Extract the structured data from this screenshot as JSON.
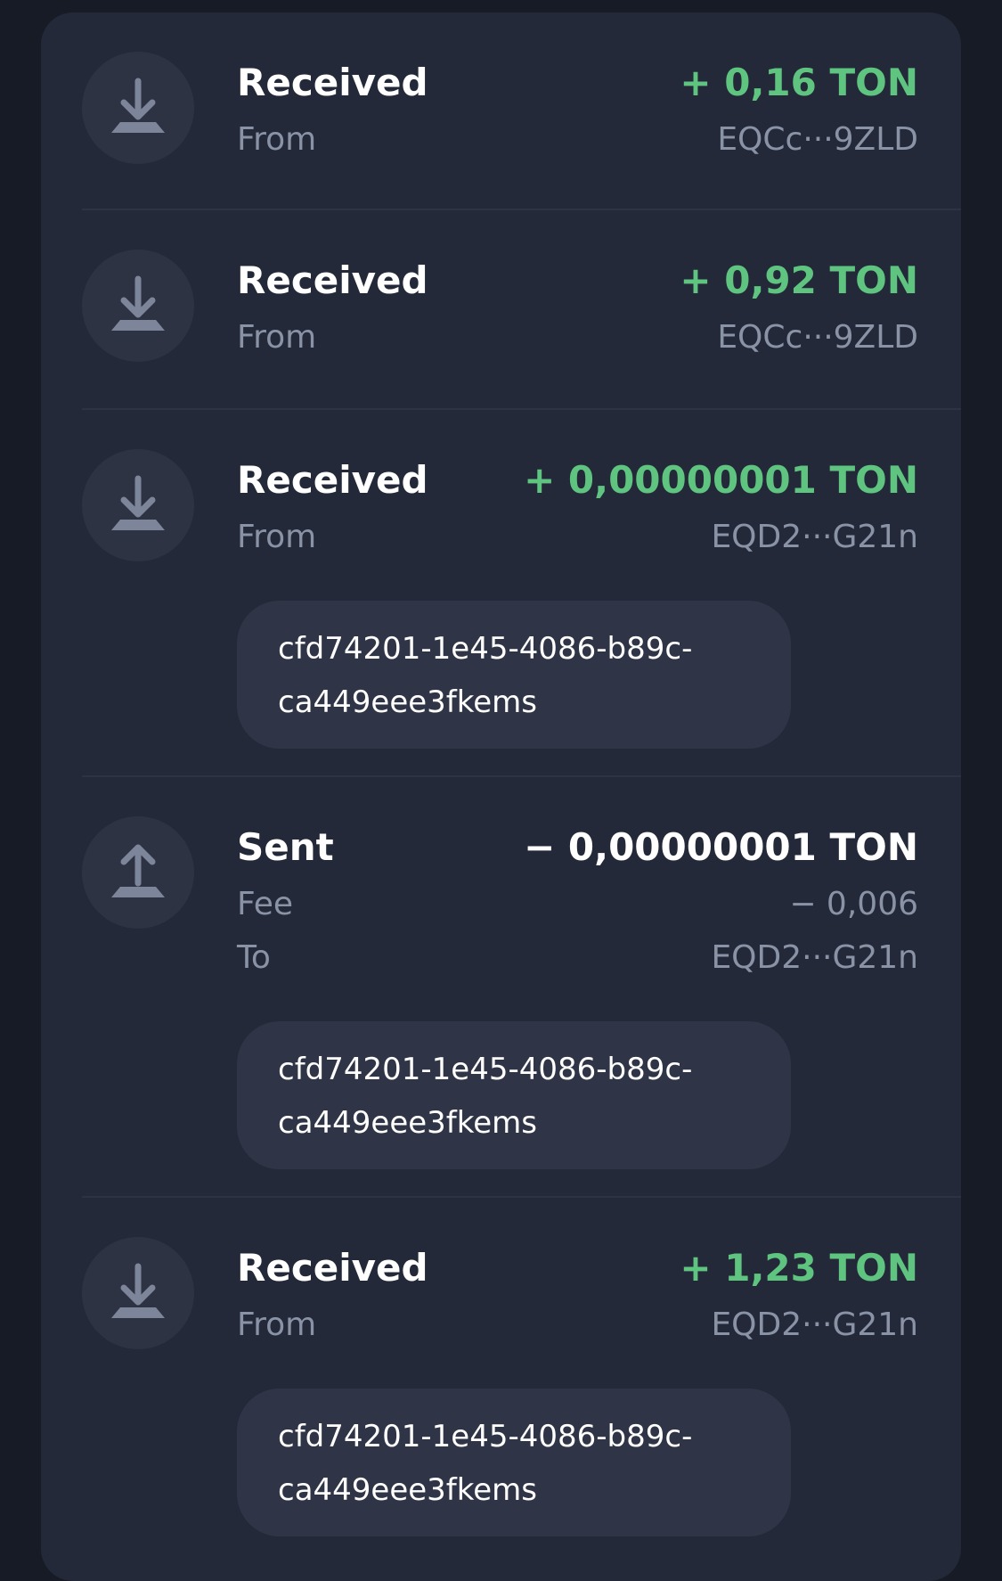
{
  "colors": {
    "background": "#161b26",
    "panel": "#232938",
    "incoming": "#5ec47f",
    "muted": "#8a93a6",
    "text": "#ffffff"
  },
  "transactions": [
    {
      "direction": "in",
      "icon": "arrow-down-icon",
      "title": "Received",
      "amount": "+ 0,16 TON",
      "address_label": "From",
      "address": "EQCc···9ZLD"
    },
    {
      "direction": "in",
      "icon": "arrow-down-icon",
      "title": "Received",
      "amount": "+ 0,92 TON",
      "address_label": "From",
      "address": "EQCc···9ZLD"
    },
    {
      "direction": "in",
      "icon": "arrow-down-icon",
      "title": "Received",
      "amount": "+ 0,00000001 TON",
      "address_label": "From",
      "address": "EQD2···G21n",
      "comment_line1": "cfd74201-1e45-4086-b89c-",
      "comment_line2": "ca449eee3fkems"
    },
    {
      "direction": "out",
      "icon": "arrow-up-icon",
      "title": "Sent",
      "amount": "− 0,00000001 TON",
      "fee_label": "Fee",
      "fee": "− 0,006",
      "address_label": "To",
      "address": "EQD2···G21n",
      "comment_line1": "cfd74201-1e45-4086-b89c-",
      "comment_line2": "ca449eee3fkems"
    },
    {
      "direction": "in",
      "icon": "arrow-down-icon",
      "title": "Received",
      "amount": "+ 1,23 TON",
      "address_label": "From",
      "address": "EQD2···G21n",
      "comment_line1": "cfd74201-1e45-4086-b89c-",
      "comment_line2": "ca449eee3fkems"
    }
  ]
}
